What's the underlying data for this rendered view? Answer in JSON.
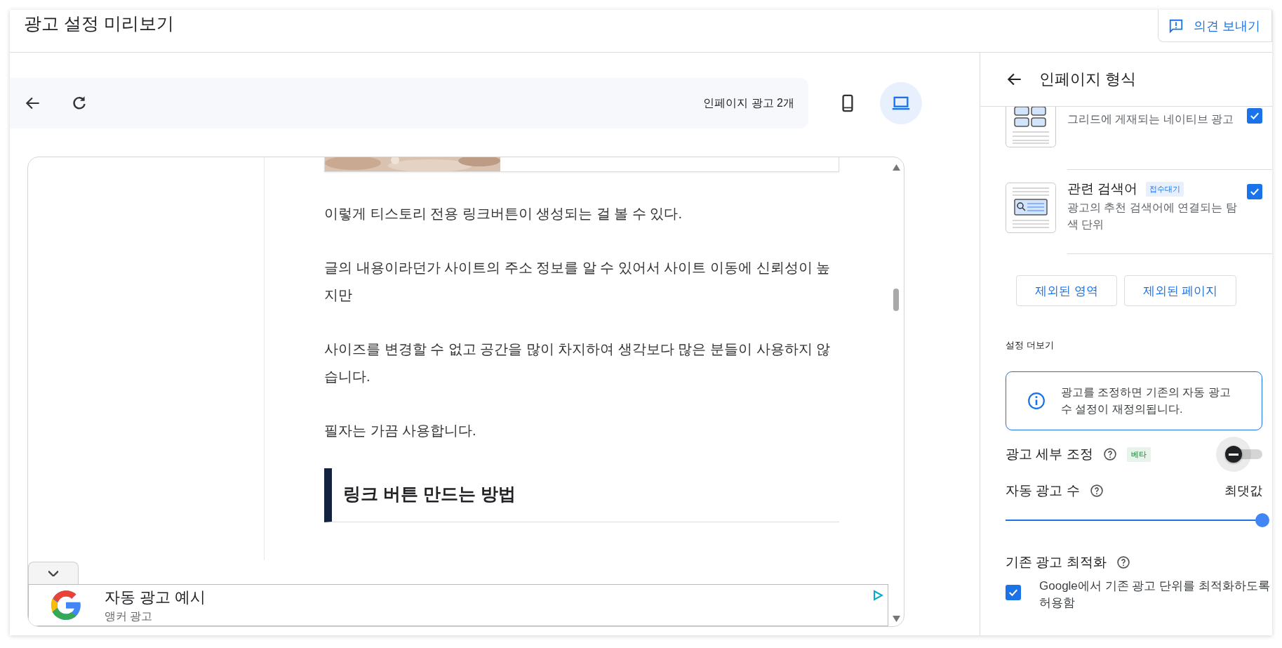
{
  "header": {
    "title": "광고 설정 미리보기",
    "feedback_button": "의견 보내기"
  },
  "preview_toolbar": {
    "ad_count": "인페이지 광고 2개",
    "devices": [
      {
        "kind": "mobile",
        "selected": false
      },
      {
        "kind": "desktop",
        "selected": true
      }
    ]
  },
  "article": {
    "paragraphs": [
      "이렇게 티스토리 전용 링크버튼이 생성되는 걸 볼 수 있다.",
      "글의 내용이라던가 사이트의 주소 정보를 알 수 있어서 사이트 이동에 신뢰성이 높지만",
      "사이즈를 변경할 수 없고 공간을 많이 차지하여 생각보다 많은 분들이 사용하지 않습니다.",
      "필자는 가끔 사용합니다."
    ],
    "heading": "링크 버튼 만드는 방법"
  },
  "anchor_ad": {
    "title": "자동 광고 예시",
    "subtitle": "앵커 광고"
  },
  "panel": {
    "title": "인페이지 형식",
    "formats": [
      {
        "kind": "grid",
        "description": "그리드에 게재되는 네이티브 광고",
        "checked": true
      },
      {
        "kind": "search",
        "name": "관련 검색어",
        "badge": "접수대기",
        "description": "광고의 추천 검색어에 연결되는 탐색 단위",
        "checked": true
      }
    ],
    "exclusion_buttons": [
      "제외된 영역",
      "제외된 페이지"
    ],
    "more_settings": {
      "heading": "설정 더보기",
      "notice": "광고를 조정하면 기존의 자동 광고 수 설정이 재정의됩니다.",
      "fine_tuning": {
        "label": "광고 세부 조정",
        "badge": "베타",
        "on": false
      },
      "ad_count": {
        "label": "자동 광고 수",
        "reading": "최댓값",
        "level": 1
      },
      "optimization": {
        "label": "기존 광고 최적화",
        "option": "Google에서 기존 광고 단위를 최적화하도록 허용함",
        "checked": true
      }
    }
  }
}
